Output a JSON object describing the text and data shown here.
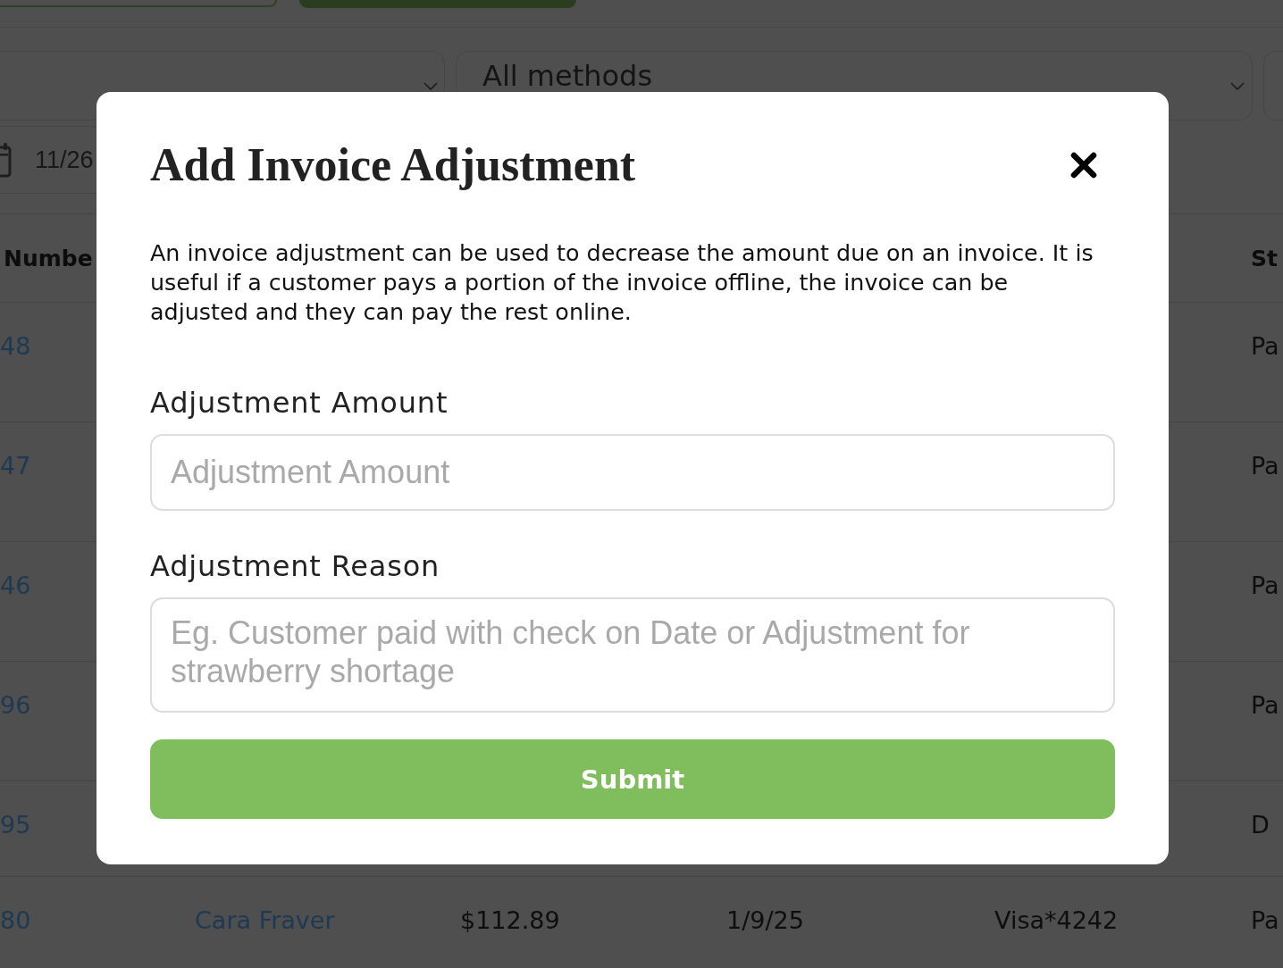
{
  "filters": {
    "method_select": {
      "value": "All methods"
    },
    "date_range": {
      "value": "11/26"
    }
  },
  "table": {
    "headers": {
      "column_1": "Numbe",
      "column_6": "St"
    },
    "rows": [
      {
        "column_1": "48",
        "column_6": "Pa"
      },
      {
        "column_1": "47",
        "column_6": "Pa"
      },
      {
        "column_1": "46",
        "column_6": "Pa"
      },
      {
        "column_1": "96",
        "column_6": "Pa"
      },
      {
        "column_1": "95",
        "column_6": "D"
      },
      {
        "column_1": "80",
        "column_2": "Cara Fraver",
        "column_3": "$112.89",
        "column_4": "1/9/25",
        "column_5": "Visa*4242",
        "column_6": "Pa"
      }
    ]
  },
  "modal": {
    "title": "Add Invoice Adjustment",
    "description": "An invoice adjustment can be used to decrease the amount due on an invoice. It is useful if a customer pays a portion of the invoice offline, the invoice can be adjusted and they can pay the rest online.",
    "fields": [
      {
        "kind": "input",
        "label": "Adjustment Amount",
        "placeholder": "Adjustment Amount"
      },
      {
        "kind": "textarea",
        "label": "Adjustment Reason",
        "placeholder": "Eg. Customer paid with check on Date or Adjustment for strawberry shortage"
      }
    ],
    "submit": "Submit"
  }
}
